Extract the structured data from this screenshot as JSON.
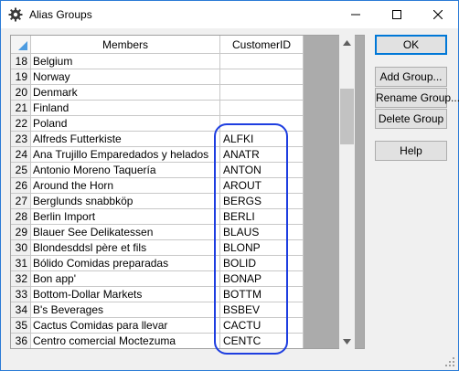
{
  "window": {
    "title": "Alias Groups"
  },
  "grid": {
    "columns": [
      "Members",
      "CustomerID"
    ],
    "rows": [
      {
        "num": "18",
        "member": "Belgium",
        "id": ""
      },
      {
        "num": "19",
        "member": "Norway",
        "id": ""
      },
      {
        "num": "20",
        "member": "Denmark",
        "id": ""
      },
      {
        "num": "21",
        "member": "Finland",
        "id": ""
      },
      {
        "num": "22",
        "member": "Poland",
        "id": ""
      },
      {
        "num": "23",
        "member": "Alfreds Futterkiste",
        "id": "ALFKI"
      },
      {
        "num": "24",
        "member": "Ana Trujillo Emparedados y helados",
        "id": "ANATR"
      },
      {
        "num": "25",
        "member": "Antonio Moreno Taquería",
        "id": "ANTON"
      },
      {
        "num": "26",
        "member": "Around the Horn",
        "id": "AROUT"
      },
      {
        "num": "27",
        "member": "Berglunds snabbköp",
        "id": "BERGS"
      },
      {
        "num": "28",
        "member": "Berlin Import",
        "id": "BERLI"
      },
      {
        "num": "29",
        "member": "Blauer See Delikatessen",
        "id": "BLAUS"
      },
      {
        "num": "30",
        "member": "Blondesddsl père et fils",
        "id": "BLONP"
      },
      {
        "num": "31",
        "member": "Bólido Comidas preparadas",
        "id": "BOLID"
      },
      {
        "num": "32",
        "member": "Bon app'",
        "id": "BONAP"
      },
      {
        "num": "33",
        "member": "Bottom-Dollar Markets",
        "id": "BOTTM"
      },
      {
        "num": "34",
        "member": "B's Beverages",
        "id": "BSBEV"
      },
      {
        "num": "35",
        "member": "Cactus Comidas para llevar",
        "id": "CACTU"
      },
      {
        "num": "36",
        "member": "Centro comercial Moctezuma",
        "id": "CENTC"
      }
    ]
  },
  "buttons": {
    "ok": "OK",
    "add_group": "Add Group...",
    "rename_group": "Rename Group...",
    "delete_group": "Delete Group",
    "help": "Help"
  },
  "colors": {
    "accent": "#0078d7",
    "highlight_circle": "#1e3ee0",
    "corner_marker": "#4d9be0"
  }
}
